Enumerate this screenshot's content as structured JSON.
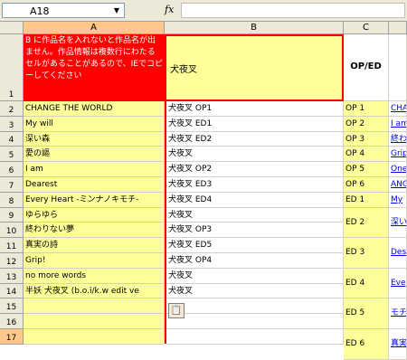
{
  "formula_bar": {
    "name_box": "A18",
    "fx": "fx",
    "formula": ""
  },
  "columns": [
    "A",
    "B",
    "C"
  ],
  "rows": [
    "1",
    "2",
    "3",
    "4",
    "5",
    "6",
    "7",
    "8",
    "9",
    "10",
    "11",
    "12",
    "13",
    "14",
    "15",
    "16",
    "17"
  ],
  "header_row": {
    "a": "B に作品名を入れないと作品名が出ません。作品情報は複数行にわたるセルがあることがあるので、IEでコピーしてください",
    "b": "犬夜叉",
    "c": "OP/ED"
  },
  "col_a": [
    "CHANGE THE WORLD",
    "My will",
    "深い森",
    "愛の謳",
    "I am",
    "Dearest",
    "Every Heart -ミンナノキモチ-",
    "ゆらゆら",
    "終わりない夢",
    "真実の詩",
    "Grip!",
    "no more words",
    "半妖 犬夜叉 (b.o.i/k.w edit ve",
    "",
    "",
    ""
  ],
  "col_b": [
    "犬夜叉 OP1",
    "犬夜叉 ED1",
    "犬夜叉 ED2",
    "犬夜叉",
    "犬夜叉 OP2",
    "犬夜叉 ED3",
    "犬夜叉 ED4",
    "犬夜叉",
    "犬夜叉 OP3",
    "犬夜叉 ED5",
    "犬夜叉 OP4",
    "犬夜叉",
    "犬夜叉",
    "",
    "",
    ""
  ],
  "col_c": [
    "OP 1",
    "OP 2",
    "OP 3",
    "OP 4",
    "OP 5",
    "OP 6",
    "ED 1",
    "ED 2",
    "ED 3",
    "ED 4",
    "ED 5",
    "ED 6"
  ],
  "col_d_links": [
    "CHA",
    "I am",
    "終わ",
    "Grip",
    "One",
    "ANG",
    "My",
    "深い",
    "Des",
    "Eve",
    "モチ",
    "真実"
  ],
  "paste_icon": "clipboard-icon"
}
